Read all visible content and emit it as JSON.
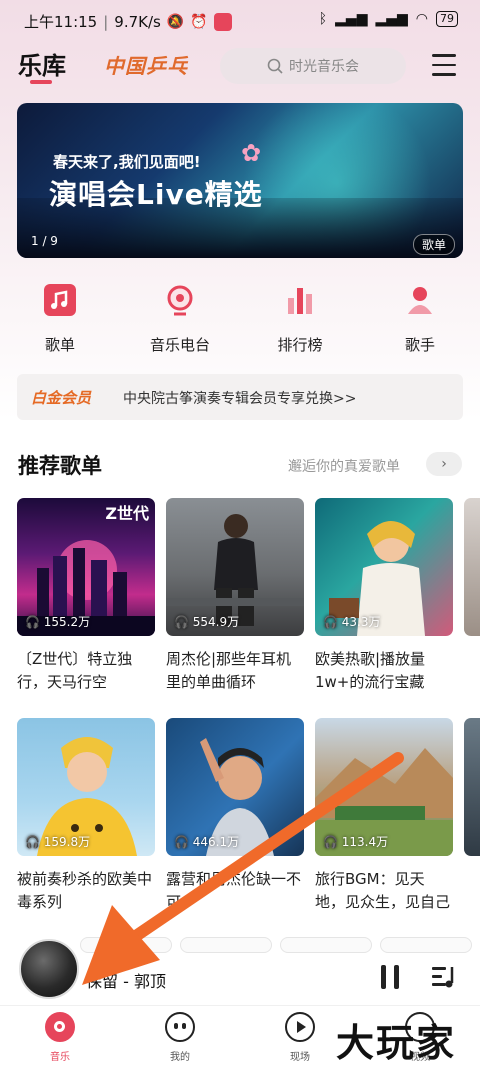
{
  "status_bar": {
    "time": "上午11:15",
    "speed": "9.7K/s",
    "battery": "79"
  },
  "header": {
    "title": "乐库",
    "promo": "中国乒乓",
    "search_placeholder": "时光音乐会"
  },
  "banner": {
    "line1": "春天来了,我们见面吧!",
    "line2": "演唱会Live精选",
    "pager": "1 / 9",
    "tag": "歌单"
  },
  "nav": [
    {
      "label": "歌单",
      "icon": "playlist-icon",
      "color": "#e6455b"
    },
    {
      "label": "音乐电台",
      "icon": "radio-icon",
      "color": "#e6455b"
    },
    {
      "label": "排行榜",
      "icon": "chart-icon",
      "color": "#e6455b"
    },
    {
      "label": "歌手",
      "icon": "singer-icon",
      "color": "#e6455b"
    }
  ],
  "vip": {
    "tag": "白金会员",
    "text": "中央院古筝演奏专辑会员专享兑换>>"
  },
  "section": {
    "title": "推荐歌单",
    "more": "邂逅你的真爱歌单"
  },
  "cards": [
    {
      "plays": "155.2万",
      "name": "〔Z世代〕特立独行，天马行空",
      "cover_tag": "Z世代"
    },
    {
      "plays": "554.9万",
      "name": "周杰伦|那些年耳机里的单曲循环",
      "cover_tag": ""
    },
    {
      "plays": "43.3万",
      "name": "欧美热歌|播放量1w+的流行宝藏",
      "cover_tag": ""
    },
    {
      "plays": "159.8万",
      "name": "被前奏秒杀的欧美中毒系列",
      "cover_tag": ""
    },
    {
      "plays": "446.1万",
      "name": "露营和周杰伦缺一不可",
      "cover_tag": ""
    },
    {
      "plays": "113.4万",
      "name": "旅行BGM：见天地，见众生，见自己",
      "cover_tag": ""
    }
  ],
  "player": {
    "song": "保留 - 郭顶"
  },
  "tabs": [
    {
      "label": "音乐",
      "active": true
    },
    {
      "label": "我的",
      "active": false
    },
    {
      "label": "现场",
      "active": false
    },
    {
      "label": "视频",
      "active": false
    }
  ],
  "watermark": "大玩家",
  "colors": {
    "accent": "#e6455b",
    "vip": "#e56a25",
    "arrow": "#f06a2a"
  }
}
